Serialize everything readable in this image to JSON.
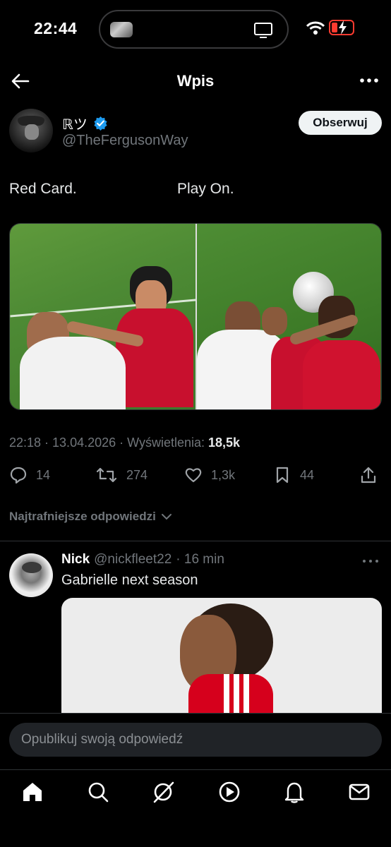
{
  "status_bar": {
    "time": "22:44",
    "battery_level": 0.2,
    "battery_color": "#ff3b30"
  },
  "header": {
    "title": "Wpis"
  },
  "tweet": {
    "author_name": "ℝツ",
    "author_handle": "@TheFergusonWay",
    "verified": true,
    "follow_label": "Obserwuj",
    "text_left": "Red Card.",
    "text_right": "Play On.",
    "timestamp": "22:18 · 13.04.2026 · Wyświetlenia:",
    "views": "18,5k",
    "replies": "14",
    "reposts": "274",
    "likes": "1,3k",
    "bookmarks": "44"
  },
  "replies_sort": {
    "label": "Najtrafniejsze odpowiedzi"
  },
  "reply": {
    "name": "Nick",
    "handle": "@nickfleet22",
    "time": "· 16 min",
    "text": "Gabrielle next season"
  },
  "composer": {
    "placeholder": "Opublikuj swoją odpowiedź"
  },
  "bottom_nav": {
    "items": [
      "home-icon",
      "search-icon",
      "grok-icon",
      "video-icon",
      "notifications-icon",
      "messages-icon"
    ]
  },
  "colors": {
    "accent": "#1d9bf0",
    "text_secondary": "#71767b",
    "background": "#000000"
  }
}
